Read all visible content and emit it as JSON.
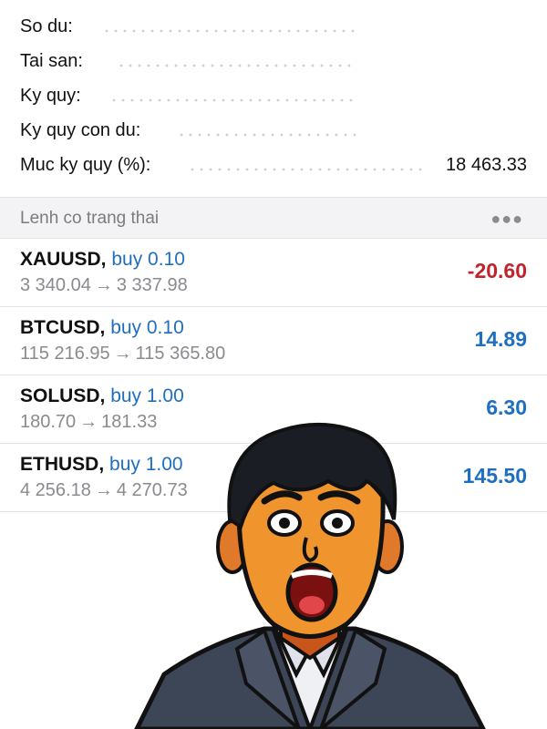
{
  "summary": {
    "rows": [
      {
        "label": "So du:",
        "value": ""
      },
      {
        "label": "Tai san:",
        "value": ""
      },
      {
        "label": "Ky quy:",
        "value": ""
      },
      {
        "label": "Ky quy con du:",
        "value": ""
      },
      {
        "label": "Muc ky quy (%):",
        "value": "18 463.33"
      }
    ]
  },
  "positions_header": {
    "title": "Lenh co trang thai",
    "more_icon": "more-horizontal-icon"
  },
  "positions": [
    {
      "symbol": "XAUUSD,",
      "direction": "buy 0.10",
      "open": "3 340.04",
      "current": "3 337.98",
      "profit": "-20.60"
    },
    {
      "symbol": "BTCUSD,",
      "direction": "buy 0.10",
      "open": "115 216.95",
      "current": "115 365.80",
      "profit": "14.89"
    },
    {
      "symbol": "SOLUSD,",
      "direction": "buy 1.00",
      "open": "180.70",
      "current": "181.33",
      "profit": "6.30"
    },
    {
      "symbol": "ETHUSD,",
      "direction": "buy 1.00",
      "open": "4 256.18",
      "current": "4 270.73",
      "profit": "145.50"
    }
  ],
  "arrow_glyph": "→",
  "colors": {
    "buy_text": "#1f6fc0",
    "profit_positive": "#1f6fc0",
    "profit_negative": "#c0232b",
    "header_bg": "#f3f3f5"
  }
}
